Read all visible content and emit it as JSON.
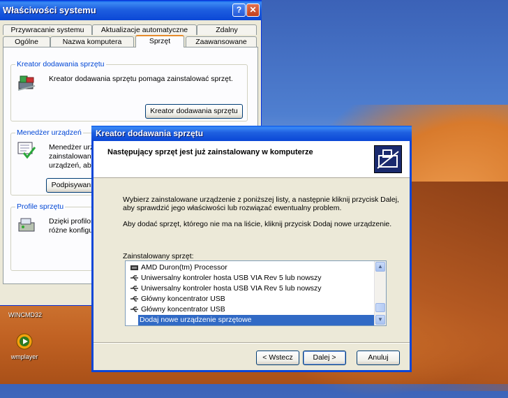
{
  "desktop": {
    "wincmd_label": "WINCMD32",
    "wmplayer_label": "wmplayer"
  },
  "sysprops": {
    "title": "Właściwości systemu",
    "help_label": "?",
    "close_label": "✕",
    "tabs_row1": [
      "Przywracanie systemu",
      "Aktualizacje automatyczne",
      "Zdalny"
    ],
    "tabs_row2": [
      "Ogólne",
      "Nazwa komputera",
      "Sprzęt",
      "Zaawansowane"
    ],
    "groups": {
      "wizard": {
        "legend": "Kreator dodawania sprzętu",
        "text": "Kreator dodawania sprzętu pomaga zainstalować sprzęt.",
        "button": "Kreator dodawania sprzętu"
      },
      "devmgr": {
        "legend": "Menedżer urządzeń",
        "text_lines": [
          "Menedżer urzą",
          "zainstalowane",
          "urządzeń, aby"
        ],
        "button": "Podpisywanie"
      },
      "profiles": {
        "legend": "Profile sprzętu",
        "text_lines": [
          "Dzięki profilom",
          "różne konfigura"
        ]
      }
    }
  },
  "wizard": {
    "title": "Kreator dodawania sprzętu",
    "header": "Następujący sprzęt jest już zainstalowany w komputerze",
    "instruction_line1": "Wybierz zainstalowane urządzenie z poniższej listy, a następnie kliknij przycisk Dalej,",
    "instruction_line2": "aby sprawdzić jego właściwości lub rozwiązać ewentualny problem.",
    "instruction_add": "Aby dodać sprzęt, którego nie ma na liście, kliknij przycisk Dodaj nowe urządzenie.",
    "list_label": "Zainstalowany sprzęt:",
    "list_items": [
      "AMD Duron(tm) Processor",
      "Uniwersalny kontroler hosta USB VIA Rev 5 lub nowszy",
      "Uniwersalny kontroler hosta USB VIA Rev 5 lub nowszy",
      "Główny koncentrator USB",
      "Główny koncentrator USB",
      "Dodaj nowe urządzenie sprzętowe"
    ],
    "scroll_up": "▲",
    "scroll_down": "▼",
    "buttons": {
      "back": "< Wstecz",
      "next": "Dalej >",
      "cancel": "Anuluj"
    }
  }
}
